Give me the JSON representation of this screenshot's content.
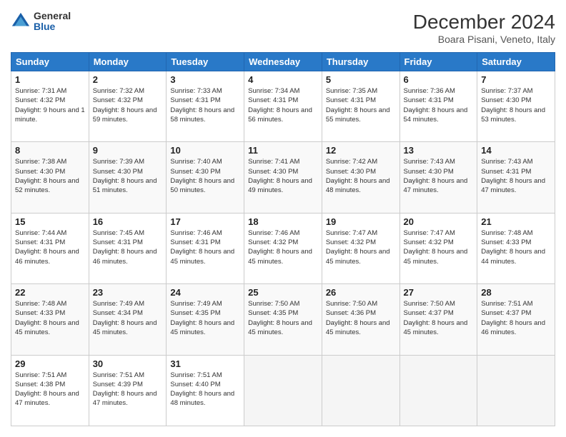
{
  "header": {
    "logo_general": "General",
    "logo_blue": "Blue",
    "month_title": "December 2024",
    "location": "Boara Pisani, Veneto, Italy"
  },
  "calendar": {
    "days_of_week": [
      "Sunday",
      "Monday",
      "Tuesday",
      "Wednesday",
      "Thursday",
      "Friday",
      "Saturday"
    ],
    "weeks": [
      [
        {
          "day": "1",
          "sunrise": "7:31 AM",
          "sunset": "4:32 PM",
          "daylight": "9 hours and 1 minute."
        },
        {
          "day": "2",
          "sunrise": "7:32 AM",
          "sunset": "4:32 PM",
          "daylight": "8 hours and 59 minutes."
        },
        {
          "day": "3",
          "sunrise": "7:33 AM",
          "sunset": "4:31 PM",
          "daylight": "8 hours and 58 minutes."
        },
        {
          "day": "4",
          "sunrise": "7:34 AM",
          "sunset": "4:31 PM",
          "daylight": "8 hours and 56 minutes."
        },
        {
          "day": "5",
          "sunrise": "7:35 AM",
          "sunset": "4:31 PM",
          "daylight": "8 hours and 55 minutes."
        },
        {
          "day": "6",
          "sunrise": "7:36 AM",
          "sunset": "4:31 PM",
          "daylight": "8 hours and 54 minutes."
        },
        {
          "day": "7",
          "sunrise": "7:37 AM",
          "sunset": "4:30 PM",
          "daylight": "8 hours and 53 minutes."
        }
      ],
      [
        {
          "day": "8",
          "sunrise": "7:38 AM",
          "sunset": "4:30 PM",
          "daylight": "8 hours and 52 minutes."
        },
        {
          "day": "9",
          "sunrise": "7:39 AM",
          "sunset": "4:30 PM",
          "daylight": "8 hours and 51 minutes."
        },
        {
          "day": "10",
          "sunrise": "7:40 AM",
          "sunset": "4:30 PM",
          "daylight": "8 hours and 50 minutes."
        },
        {
          "day": "11",
          "sunrise": "7:41 AM",
          "sunset": "4:30 PM",
          "daylight": "8 hours and 49 minutes."
        },
        {
          "day": "12",
          "sunrise": "7:42 AM",
          "sunset": "4:30 PM",
          "daylight": "8 hours and 48 minutes."
        },
        {
          "day": "13",
          "sunrise": "7:43 AM",
          "sunset": "4:30 PM",
          "daylight": "8 hours and 47 minutes."
        },
        {
          "day": "14",
          "sunrise": "7:43 AM",
          "sunset": "4:31 PM",
          "daylight": "8 hours and 47 minutes."
        }
      ],
      [
        {
          "day": "15",
          "sunrise": "7:44 AM",
          "sunset": "4:31 PM",
          "daylight": "8 hours and 46 minutes."
        },
        {
          "day": "16",
          "sunrise": "7:45 AM",
          "sunset": "4:31 PM",
          "daylight": "8 hours and 46 minutes."
        },
        {
          "day": "17",
          "sunrise": "7:46 AM",
          "sunset": "4:31 PM",
          "daylight": "8 hours and 45 minutes."
        },
        {
          "day": "18",
          "sunrise": "7:46 AM",
          "sunset": "4:32 PM",
          "daylight": "8 hours and 45 minutes."
        },
        {
          "day": "19",
          "sunrise": "7:47 AM",
          "sunset": "4:32 PM",
          "daylight": "8 hours and 45 minutes."
        },
        {
          "day": "20",
          "sunrise": "7:47 AM",
          "sunset": "4:32 PM",
          "daylight": "8 hours and 45 minutes."
        },
        {
          "day": "21",
          "sunrise": "7:48 AM",
          "sunset": "4:33 PM",
          "daylight": "8 hours and 44 minutes."
        }
      ],
      [
        {
          "day": "22",
          "sunrise": "7:48 AM",
          "sunset": "4:33 PM",
          "daylight": "8 hours and 45 minutes."
        },
        {
          "day": "23",
          "sunrise": "7:49 AM",
          "sunset": "4:34 PM",
          "daylight": "8 hours and 45 minutes."
        },
        {
          "day": "24",
          "sunrise": "7:49 AM",
          "sunset": "4:35 PM",
          "daylight": "8 hours and 45 minutes."
        },
        {
          "day": "25",
          "sunrise": "7:50 AM",
          "sunset": "4:35 PM",
          "daylight": "8 hours and 45 minutes."
        },
        {
          "day": "26",
          "sunrise": "7:50 AM",
          "sunset": "4:36 PM",
          "daylight": "8 hours and 45 minutes."
        },
        {
          "day": "27",
          "sunrise": "7:50 AM",
          "sunset": "4:37 PM",
          "daylight": "8 hours and 45 minutes."
        },
        {
          "day": "28",
          "sunrise": "7:51 AM",
          "sunset": "4:37 PM",
          "daylight": "8 hours and 46 minutes."
        }
      ],
      [
        {
          "day": "29",
          "sunrise": "7:51 AM",
          "sunset": "4:38 PM",
          "daylight": "8 hours and 47 minutes."
        },
        {
          "day": "30",
          "sunrise": "7:51 AM",
          "sunset": "4:39 PM",
          "daylight": "8 hours and 47 minutes."
        },
        {
          "day": "31",
          "sunrise": "7:51 AM",
          "sunset": "4:40 PM",
          "daylight": "8 hours and 48 minutes."
        },
        null,
        null,
        null,
        null
      ]
    ],
    "labels": {
      "sunrise": "Sunrise:",
      "sunset": "Sunset:",
      "daylight": "Daylight:"
    }
  }
}
